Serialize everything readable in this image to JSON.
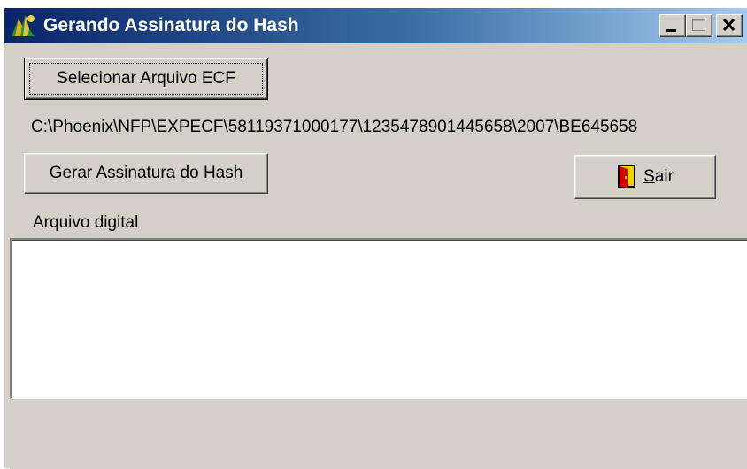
{
  "window": {
    "title": "Gerando Assinatura do Hash",
    "controls": {
      "minimize_icon": "minimize-icon",
      "maximize_icon": "maximize-icon",
      "close_icon": "close-icon"
    }
  },
  "form": {
    "select_button_label": "Selecionar Arquivo ECF",
    "file_path": "C:\\Phoenix\\NFP\\EXPECF\\58119371000177\\1235478901445658\\2007\\BE645658",
    "generate_button_label": "Gerar Assinatura do Hash",
    "exit_button_label": "Sair",
    "exit_button_mnemonic": "S",
    "exit_button_rest": "air",
    "digital_file_label": "Arquivo digital",
    "digital_file_content": ""
  },
  "icons": {
    "app": "app-icon",
    "exit": "door-exit-icon"
  },
  "colors": {
    "titlebar_start": "#0a246a",
    "titlebar_end": "#a6caf0",
    "face": "#d4d0c8"
  }
}
